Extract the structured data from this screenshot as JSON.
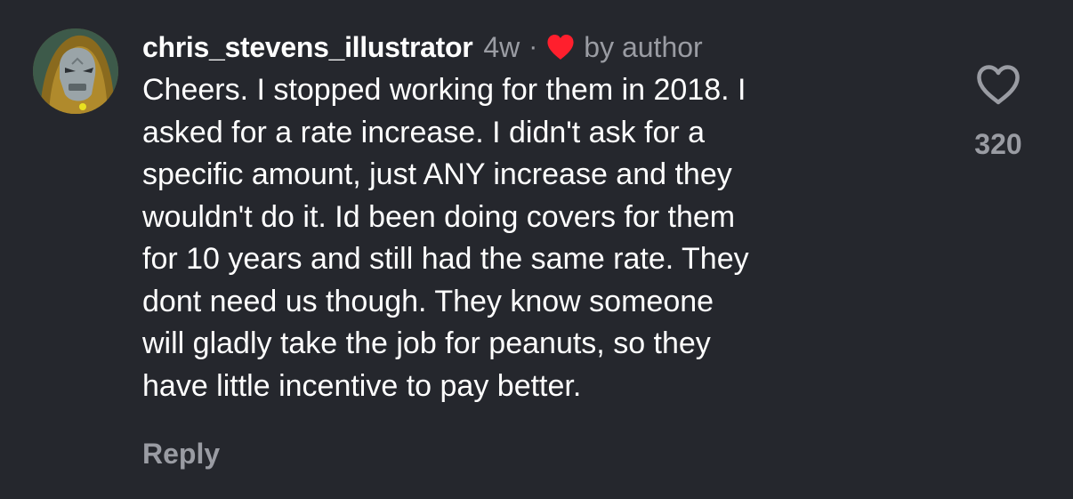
{
  "comment": {
    "username": "chris_stevens_illustrator",
    "timestamp": "4w",
    "separator": "·",
    "liked_by_author_label": "by author",
    "text": "Cheers. I stopped working for them in 2018. I\nasked for a rate increase. I didn't ask for a\nspecific amount, just ANY increase and they\nwouldn't do it. Id been doing covers for them\nfor 10 years and still had the same rate. They\ndont need us though. They know someone\nwill gladly take the job for peanuts, so they\nhave little incentive to pay better.",
    "reply_label": "Reply",
    "like_count": "320"
  },
  "icons": {
    "author_heart": "heart-filled-icon",
    "like": "heart-outline-icon"
  },
  "colors": {
    "background": "#25272d",
    "primary_text": "#ffffff",
    "secondary_text": "#9a9ca3",
    "author_heart": "#ff1f2d"
  }
}
